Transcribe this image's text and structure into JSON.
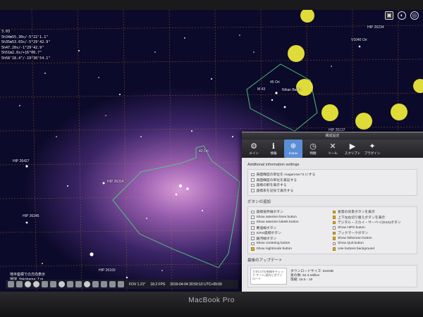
{
  "device": {
    "label": "MacBook Pro"
  },
  "object_info": [
    "3.03",
    "5h34m55.30s/-5°22'1.1\"",
    "5h35m53.03s/-5°29'42.9\"",
    "5h47.20s/-1°29'42.9\"",
    "5h51m2.6s/+16°00.7\"",
    "5h58'18.4\"/-19°30'54.1\""
  ],
  "sky_labels": {
    "hip_26234": "HIP 26234",
    "v1040_ori": "V1040 Ori",
    "ori_45": "45 Ori",
    "m43": "M 43",
    "nihan_batil": "Nihan Batil I",
    "hip_26137": "HIP 26137",
    "hip_26427": "HIP 26427",
    "hip_26314": "HIP 26314",
    "ngc_label": "42 Ori",
    "hip_26345": "HIP 26345",
    "hip_26160": "HIP 26160"
  },
  "status": {
    "line": "地平座標での方向表示",
    "location": "地球, Yokohama, 7 m"
  },
  "bottom_bar": {
    "fov": "FOV 1.21°",
    "fps": "18.2 FPS",
    "datetime": "2019-04-04 20:50:10 UTC+09:00"
  },
  "dialog": {
    "title": "構成設定",
    "tabs": [
      {
        "label": "メイン",
        "icon": "⚙"
      },
      {
        "label": "情報",
        "icon": "ℹ"
      },
      {
        "label": "Extras",
        "icon": "❄"
      },
      {
        "label": "時間",
        "icon": "◷"
      },
      {
        "label": "ツール",
        "icon": "✕"
      },
      {
        "label": "スクリプト",
        "icon": "▶"
      },
      {
        "label": "プラグイン",
        "icon": "✦"
      }
    ],
    "additional_title": "Additional information settings",
    "additional_items": [
      "表面輝度の単位を magarcsec^2 にする",
      "表面輝度の単位を表記する",
      "座標の軒を表示する",
      "座標系を記号で表示する"
    ],
    "buttons_title": "ボタンの追加",
    "buttons_left": [
      {
        "label": "座標境界線ボタン",
        "checked": false
      },
      {
        "label": "Show asterism lines button",
        "checked": false
      },
      {
        "label": "Show asterism labels button",
        "checked": false
      },
      {
        "label": "黄道線ボタン",
        "checked": false
      },
      {
        "label": "ICRS座標ボタン",
        "checked": false
      },
      {
        "label": "銀河線ボタン",
        "checked": false
      },
      {
        "label": "Show centering button",
        "checked": false
      },
      {
        "label": "Show nightmode button",
        "checked": true
      }
    ],
    "buttons_right": [
      {
        "label": "星雲の背景ボタンを表示",
        "checked": true
      },
      {
        "label": "上下左右切り替えボタンを表示",
        "checked": true
      },
      {
        "label": "デジタル・スカイ・サーベイ(DSS)ボタン",
        "checked": true
      },
      {
        "label": "Show HiPS button",
        "checked": false
      },
      {
        "label": "ブックマークボタン",
        "checked": true
      },
      {
        "label": "Show fullscreen button",
        "checked": true
      },
      {
        "label": "Show Quit button",
        "checked": false
      },
      {
        "label": "Use buttons background",
        "checked": true
      }
    ],
    "update_title": "最後のアップデート",
    "update_thumb": "カタログの有無をチェック\nサーバ-案内とダウンロード",
    "update_lines": [
      "ダウンロードサイズ: 534MB",
      "星の数: 92.3 Million",
      "等級: 16.5 - 18"
    ]
  },
  "colors": {
    "grid": "#d27a2c",
    "constellation": "#4fd07a",
    "highlight": "#f6f23a",
    "dialog_accent": "#5a8ed6"
  }
}
